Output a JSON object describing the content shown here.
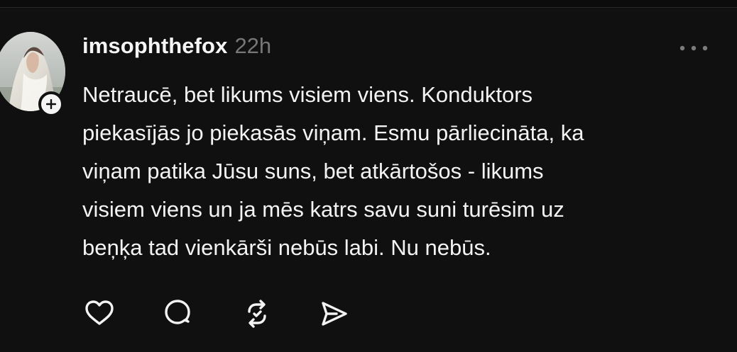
{
  "post": {
    "username": "imsophthefox",
    "timestamp": "22h",
    "text": "Netraucē, bet likums visiem viens. Konduktors\npiekasījās jo piekasās viņam. Esmu pārliecināta, ka\nviņam patika Jūsu suns, bet atkārtošos - likums\nvisiem viens un ja mēs katrs savu suni turēsim uz\nbeņķa tad vienkārši nebūs labi. Nu nebūs."
  },
  "icons": {
    "follow": "plus-icon",
    "more": "more-options-icon",
    "like": "heart-icon",
    "reply": "comment-icon",
    "repost": "repost-icon",
    "share": "send-icon"
  },
  "colors": {
    "background": "#101010",
    "text": "#f3f3f3",
    "muted": "#777777"
  }
}
